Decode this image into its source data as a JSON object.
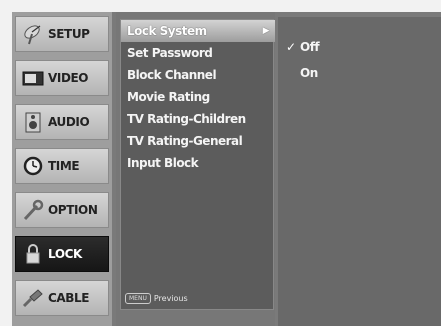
{
  "tabs": [
    {
      "label": "SETUP",
      "icon": "satellite-dish-icon"
    },
    {
      "label": "VIDEO",
      "icon": "monitor-icon"
    },
    {
      "label": "AUDIO",
      "icon": "speaker-icon"
    },
    {
      "label": "TIME",
      "icon": "clock-icon"
    },
    {
      "label": "OPTION",
      "icon": "wrench-icon"
    },
    {
      "label": "LOCK",
      "icon": "padlock-icon",
      "active": true
    },
    {
      "label": "CABLE",
      "icon": "cable-icon"
    }
  ],
  "submenu": {
    "items": [
      {
        "label": "Lock System",
        "selected": true
      },
      {
        "label": "Set Password"
      },
      {
        "label": "Block Channel"
      },
      {
        "label": "Movie Rating"
      },
      {
        "label": "TV Rating-Children"
      },
      {
        "label": "TV Rating-General"
      },
      {
        "label": "Input Block"
      }
    ],
    "footer_key": "MENU",
    "footer_label": "Previous"
  },
  "options": {
    "items": [
      {
        "label": "Off",
        "checked": true
      },
      {
        "label": "On"
      }
    ]
  },
  "colors": {
    "active_tab": "#1e1e1e",
    "selected_item": "#bcbcbc"
  }
}
